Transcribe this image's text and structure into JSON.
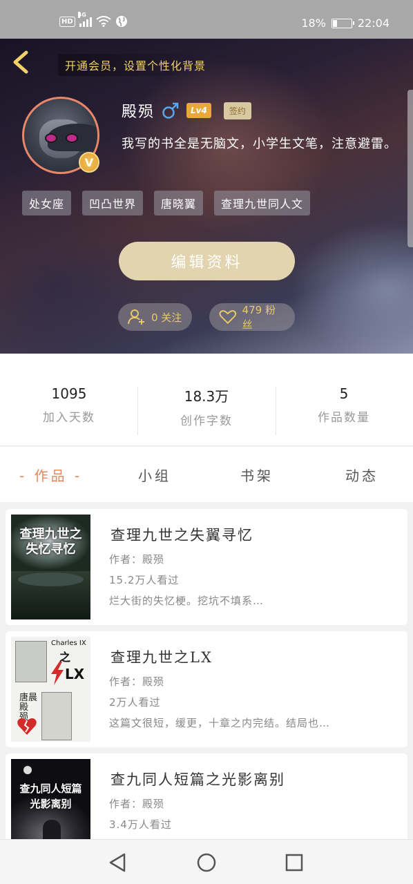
{
  "status_bar": {
    "network_label": "HD",
    "signal_label": "4G",
    "battery": "18%",
    "time": "22:04"
  },
  "header": {
    "vip_banner": "开通会员，设置个性化背景",
    "username": "殿殒",
    "gender_symbol": "♂",
    "level": "Lv4",
    "sign_badge": "签约",
    "verified_badge": "V",
    "bio": "我写的书全是无脑文，小学生文笔，注意避雷。",
    "tags": [
      "处女座",
      "凹凸世界",
      "唐晓翼",
      "查理九世同人文"
    ],
    "edit_button": "编辑资料",
    "following": "0 关注",
    "followers": "479 粉丝"
  },
  "stats": [
    {
      "value": "1095",
      "label": "加入天数"
    },
    {
      "value": "18.3万",
      "label": "创作字数"
    },
    {
      "value": "5",
      "label": "作品数量"
    }
  ],
  "tabs": [
    {
      "label": "- 作品 -",
      "active": true
    },
    {
      "label": "小组",
      "active": false
    },
    {
      "label": "书架",
      "active": false
    },
    {
      "label": "动态",
      "active": false
    }
  ],
  "books": [
    {
      "title": "查理九世之失翼寻忆",
      "author": "作者：殿殒",
      "views": "15.2万人看过",
      "desc": "烂大街的失忆梗。挖坑不填系…",
      "cover_text": "查理九世之失忆寻忆"
    },
    {
      "title": "查理九世之LX",
      "author": "作者：殿殒",
      "views": "2万人看过",
      "desc": "这篇文很短，缓更，十章之内完结。结局也…",
      "cover_text_top": "Charles IX",
      "cover_text_mid": "之",
      "cover_text_lx": "LX",
      "cover_text_side": "唐晨 殿 殒"
    },
    {
      "title": "查九同人短篇之光影离别",
      "author": "作者：殿殒",
      "views": "3.4万人看过",
      "desc": "",
      "cover_text": "查九同人短篇光影离别"
    }
  ],
  "colors": {
    "accent": "#e8875a",
    "gold": "#f2d06a",
    "edit_button_bg": "#e2d4ae"
  }
}
